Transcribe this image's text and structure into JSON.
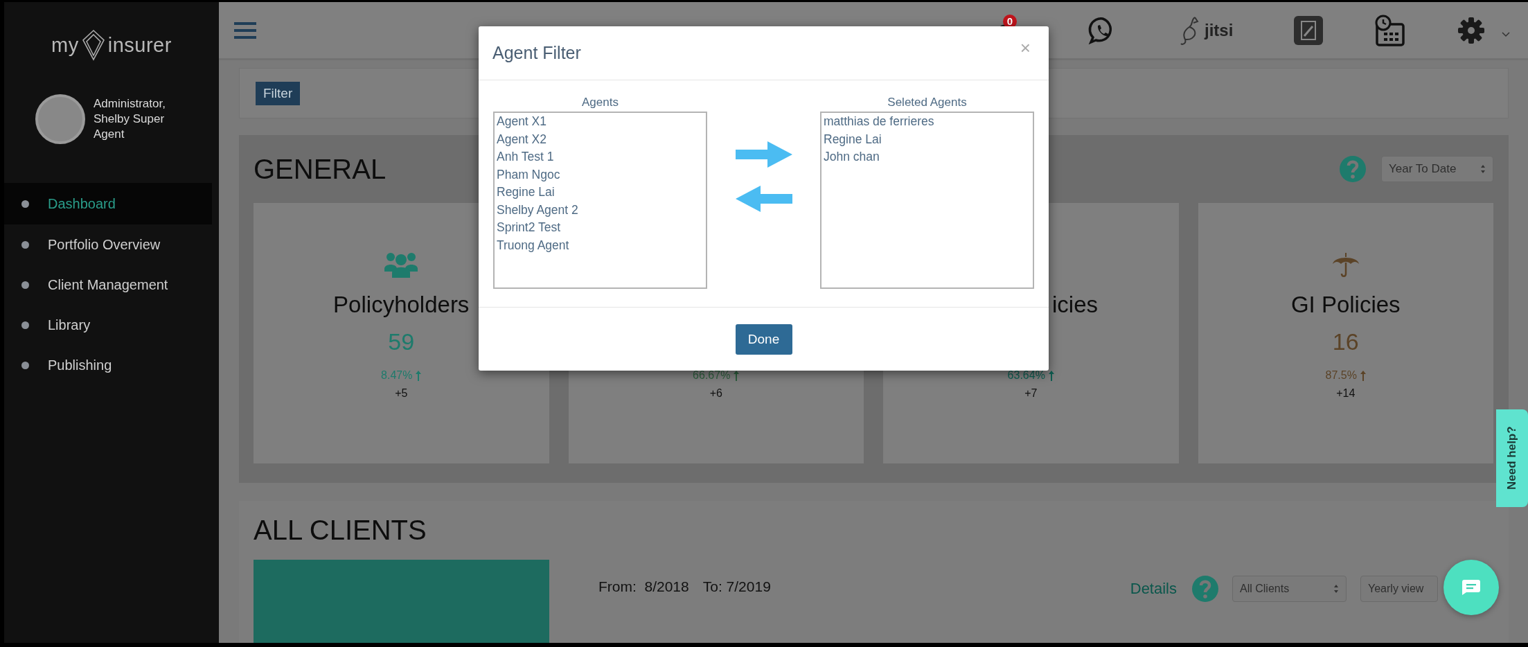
{
  "sidebar": {
    "logo": {
      "left": "my",
      "right": "insurer"
    },
    "user": "Administrator, Shelby Super Agent",
    "items": [
      {
        "label": "Dashboard",
        "selected": true
      },
      {
        "label": "Portfolio Overview",
        "selected": false
      },
      {
        "label": "Client Management",
        "selected": false
      },
      {
        "label": "Library",
        "selected": false
      },
      {
        "label": "Publishing",
        "selected": false
      }
    ]
  },
  "topbar": {
    "notification_count": "0",
    "video_app": "jitsi"
  },
  "filter_button": "Filter",
  "general": {
    "title": "GENERAL",
    "period": "Year To Date",
    "cards": [
      {
        "title": "Policyholders",
        "value": "59",
        "change": "8.47%",
        "delta": "+5",
        "color": "#1e7b6c"
      },
      {
        "change": "66.67%",
        "delta": "+6",
        "color": "#2f5f3f"
      },
      {
        "title": "icies",
        "change": "63.64%",
        "delta": "+7",
        "color": "#0f5e52"
      },
      {
        "title": "GI Policies",
        "value": "16",
        "change": "87.5%",
        "delta": "+14",
        "color": "#5b4327"
      }
    ]
  },
  "all_clients": {
    "title": "ALL CLIENTS",
    "range": [
      "From:  8/2018",
      "To: 7/2019"
    ],
    "details_link": "Details",
    "client_filter": "All Clients",
    "view": "Yearly view"
  },
  "modal": {
    "title": "Agent Filter",
    "close": "×",
    "available": {
      "label": "Agents",
      "items": [
        "Agent X1",
        "Agent X2",
        "Anh Test 1",
        "Pham Ngoc",
        "Regine Lai",
        "Shelby Agent 2",
        "Sprint2 Test",
        "Truong Agent"
      ]
    },
    "selected": {
      "label": "Seleted Agents",
      "items": [
        "matthias de ferrieres",
        "Regine Lai",
        "John chan"
      ]
    },
    "done": "Done"
  },
  "help_tab": "Need help?"
}
